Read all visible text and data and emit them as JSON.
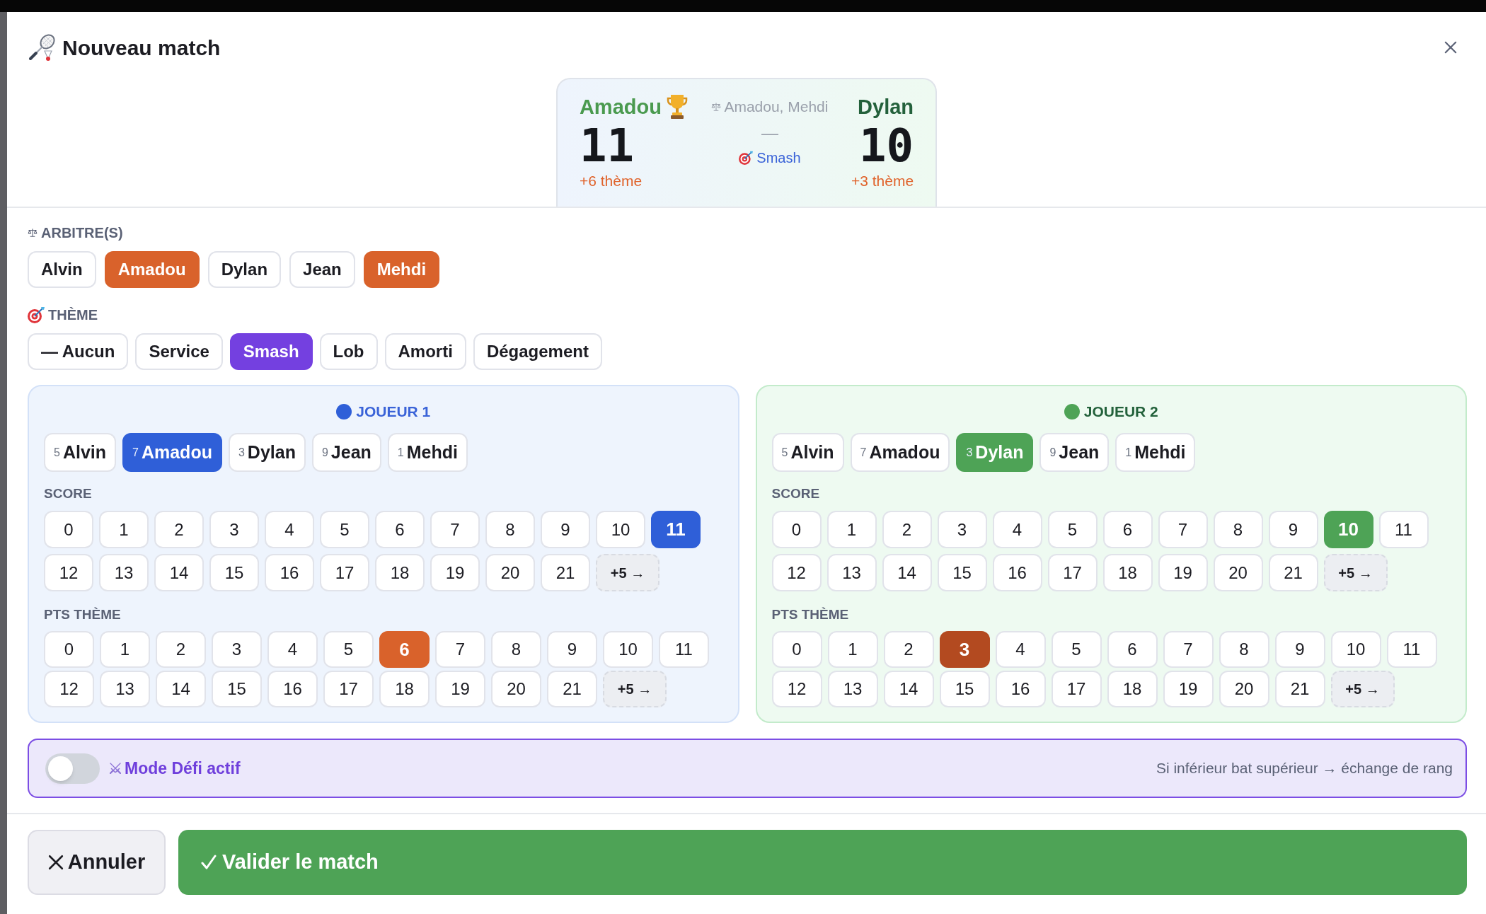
{
  "dialog": {
    "title": "Nouveau match"
  },
  "scoreboard": {
    "left": {
      "name": "Amadou",
      "winner": true,
      "score": "11",
      "bonus": "+6 thème"
    },
    "referees": "Amadou, Mehdi",
    "separator": "—",
    "theme": "Smash",
    "right": {
      "name": "Dylan",
      "winner": false,
      "score": "10",
      "bonus": "+3 thème"
    }
  },
  "referees": {
    "label": "ARBITRE(S)",
    "options": [
      {
        "label": "Alvin",
        "selected": false
      },
      {
        "label": "Amadou",
        "selected": true
      },
      {
        "label": "Dylan",
        "selected": false
      },
      {
        "label": "Jean",
        "selected": false
      },
      {
        "label": "Mehdi",
        "selected": true
      }
    ]
  },
  "theme": {
    "label": "THÈME",
    "options": [
      {
        "label": "— Aucun",
        "selected": false
      },
      {
        "label": "Service",
        "selected": false
      },
      {
        "label": "Smash",
        "selected": true
      },
      {
        "label": "Lob",
        "selected": false
      },
      {
        "label": "Amorti",
        "selected": false
      },
      {
        "label": "Dégagement",
        "selected": false
      }
    ]
  },
  "players": [
    {
      "title": "JOUEUR 1",
      "color": "#2f5fd8",
      "roster": [
        {
          "rank": "5",
          "name": "Alvin",
          "selected": false
        },
        {
          "rank": "7",
          "name": "Amadou",
          "selected": true
        },
        {
          "rank": "3",
          "name": "Dylan",
          "selected": false
        },
        {
          "rank": "9",
          "name": "Jean",
          "selected": false
        },
        {
          "rank": "1",
          "name": "Mehdi",
          "selected": false
        }
      ],
      "score": {
        "label": "SCORE",
        "options": [
          {
            "label": "0",
            "selected": false
          },
          {
            "label": "1",
            "selected": false
          },
          {
            "label": "2",
            "selected": false
          },
          {
            "label": "3",
            "selected": false
          },
          {
            "label": "4",
            "selected": false
          },
          {
            "label": "5",
            "selected": false
          },
          {
            "label": "6",
            "selected": false
          },
          {
            "label": "7",
            "selected": false
          },
          {
            "label": "8",
            "selected": false
          },
          {
            "label": "9",
            "selected": false
          },
          {
            "label": "10",
            "selected": false
          },
          {
            "label": "11",
            "selected": true
          },
          {
            "label": "12",
            "selected": false
          },
          {
            "label": "13",
            "selected": false
          },
          {
            "label": "14",
            "selected": false
          },
          {
            "label": "15",
            "selected": false
          },
          {
            "label": "16",
            "selected": false
          },
          {
            "label": "17",
            "selected": false
          },
          {
            "label": "18",
            "selected": false
          },
          {
            "label": "19",
            "selected": false
          },
          {
            "label": "20",
            "selected": false
          },
          {
            "label": "21",
            "selected": false
          }
        ],
        "more": "+5 →"
      },
      "theme_points": {
        "label": "PTS THÈME",
        "options": [
          {
            "label": "0",
            "selected": false
          },
          {
            "label": "1",
            "selected": false
          },
          {
            "label": "2",
            "selected": false
          },
          {
            "label": "3",
            "selected": false
          },
          {
            "label": "4",
            "selected": false
          },
          {
            "label": "5",
            "selected": false
          },
          {
            "label": "6",
            "selected": true
          },
          {
            "label": "7",
            "selected": false
          },
          {
            "label": "8",
            "selected": false
          },
          {
            "label": "9",
            "selected": false
          },
          {
            "label": "10",
            "selected": false
          },
          {
            "label": "11",
            "selected": false
          },
          {
            "label": "12",
            "selected": false
          },
          {
            "label": "13",
            "selected": false
          },
          {
            "label": "14",
            "selected": false
          },
          {
            "label": "15",
            "selected": false
          },
          {
            "label": "16",
            "selected": false
          },
          {
            "label": "17",
            "selected": false
          },
          {
            "label": "18",
            "selected": false
          },
          {
            "label": "19",
            "selected": false
          },
          {
            "label": "20",
            "selected": false
          },
          {
            "label": "21",
            "selected": false
          }
        ],
        "more": "+5 →"
      }
    },
    {
      "title": "JOUEUR 2",
      "color": "#4ea356",
      "roster": [
        {
          "rank": "5",
          "name": "Alvin",
          "selected": false
        },
        {
          "rank": "7",
          "name": "Amadou",
          "selected": false
        },
        {
          "rank": "3",
          "name": "Dylan",
          "selected": true
        },
        {
          "rank": "9",
          "name": "Jean",
          "selected": false
        },
        {
          "rank": "1",
          "name": "Mehdi",
          "selected": false
        }
      ],
      "score": {
        "label": "SCORE",
        "options": [
          {
            "label": "0",
            "selected": false
          },
          {
            "label": "1",
            "selected": false
          },
          {
            "label": "2",
            "selected": false
          },
          {
            "label": "3",
            "selected": false
          },
          {
            "label": "4",
            "selected": false
          },
          {
            "label": "5",
            "selected": false
          },
          {
            "label": "6",
            "selected": false
          },
          {
            "label": "7",
            "selected": false
          },
          {
            "label": "8",
            "selected": false
          },
          {
            "label": "9",
            "selected": false
          },
          {
            "label": "10",
            "selected": true
          },
          {
            "label": "11",
            "selected": false
          },
          {
            "label": "12",
            "selected": false
          },
          {
            "label": "13",
            "selected": false
          },
          {
            "label": "14",
            "selected": false
          },
          {
            "label": "15",
            "selected": false
          },
          {
            "label": "16",
            "selected": false
          },
          {
            "label": "17",
            "selected": false
          },
          {
            "label": "18",
            "selected": false
          },
          {
            "label": "19",
            "selected": false
          },
          {
            "label": "20",
            "selected": false
          },
          {
            "label": "21",
            "selected": false
          }
        ],
        "more": "+5 →"
      },
      "theme_points": {
        "label": "PTS THÈME",
        "options": [
          {
            "label": "0",
            "selected": false
          },
          {
            "label": "1",
            "selected": false
          },
          {
            "label": "2",
            "selected": false
          },
          {
            "label": "3",
            "selected": true
          },
          {
            "label": "4",
            "selected": false
          },
          {
            "label": "5",
            "selected": false
          },
          {
            "label": "6",
            "selected": false
          },
          {
            "label": "7",
            "selected": false
          },
          {
            "label": "8",
            "selected": false
          },
          {
            "label": "9",
            "selected": false
          },
          {
            "label": "10",
            "selected": false
          },
          {
            "label": "11",
            "selected": false
          },
          {
            "label": "12",
            "selected": false
          },
          {
            "label": "13",
            "selected": false
          },
          {
            "label": "14",
            "selected": false
          },
          {
            "label": "15",
            "selected": false
          },
          {
            "label": "16",
            "selected": false
          },
          {
            "label": "17",
            "selected": false
          },
          {
            "label": "18",
            "selected": false
          },
          {
            "label": "19",
            "selected": false
          },
          {
            "label": "20",
            "selected": false
          },
          {
            "label": "21",
            "selected": false
          }
        ],
        "more": "+5 →"
      }
    }
  ],
  "challenge": {
    "on": false,
    "label": "Mode Défi actif",
    "hint": "Si inférieur bat supérieur → échange de rang"
  },
  "footer": {
    "cancel": "Annuler",
    "confirm": "Valider le match"
  }
}
